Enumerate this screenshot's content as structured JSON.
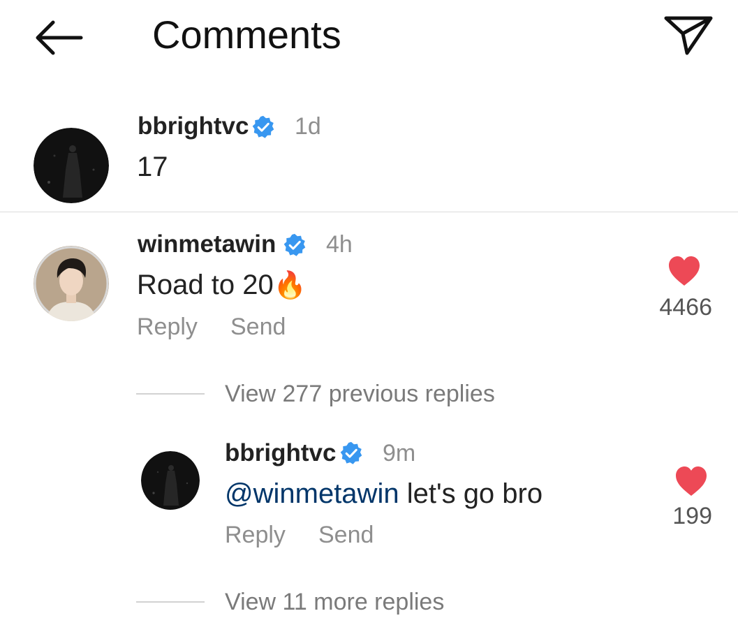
{
  "header": {
    "title": "Comments",
    "back_icon": "arrow-left-icon",
    "share_icon": "paper-plane-icon"
  },
  "caption": {
    "username": "bbrightvc",
    "verified": true,
    "time": "1d",
    "text": "17"
  },
  "comment": {
    "username": "winmetawin",
    "verified": true,
    "time": "4h",
    "text": "Road to 20",
    "emoji": "🔥",
    "likes": "4466",
    "reply_label": "Reply",
    "send_label": "Send"
  },
  "view_previous": "View 277 previous replies",
  "reply": {
    "username": "bbrightvc",
    "verified": true,
    "time": "9m",
    "mention": "@winmetawin",
    "text": " let's go bro",
    "likes": "199",
    "reply_label": "Reply",
    "send_label": "Send"
  },
  "view_more": "View 11 more replies",
  "colors": {
    "verified": "#3897f0",
    "heart": "#ed4956",
    "mention": "#003569",
    "secondary_text": "#8e8e8e"
  }
}
